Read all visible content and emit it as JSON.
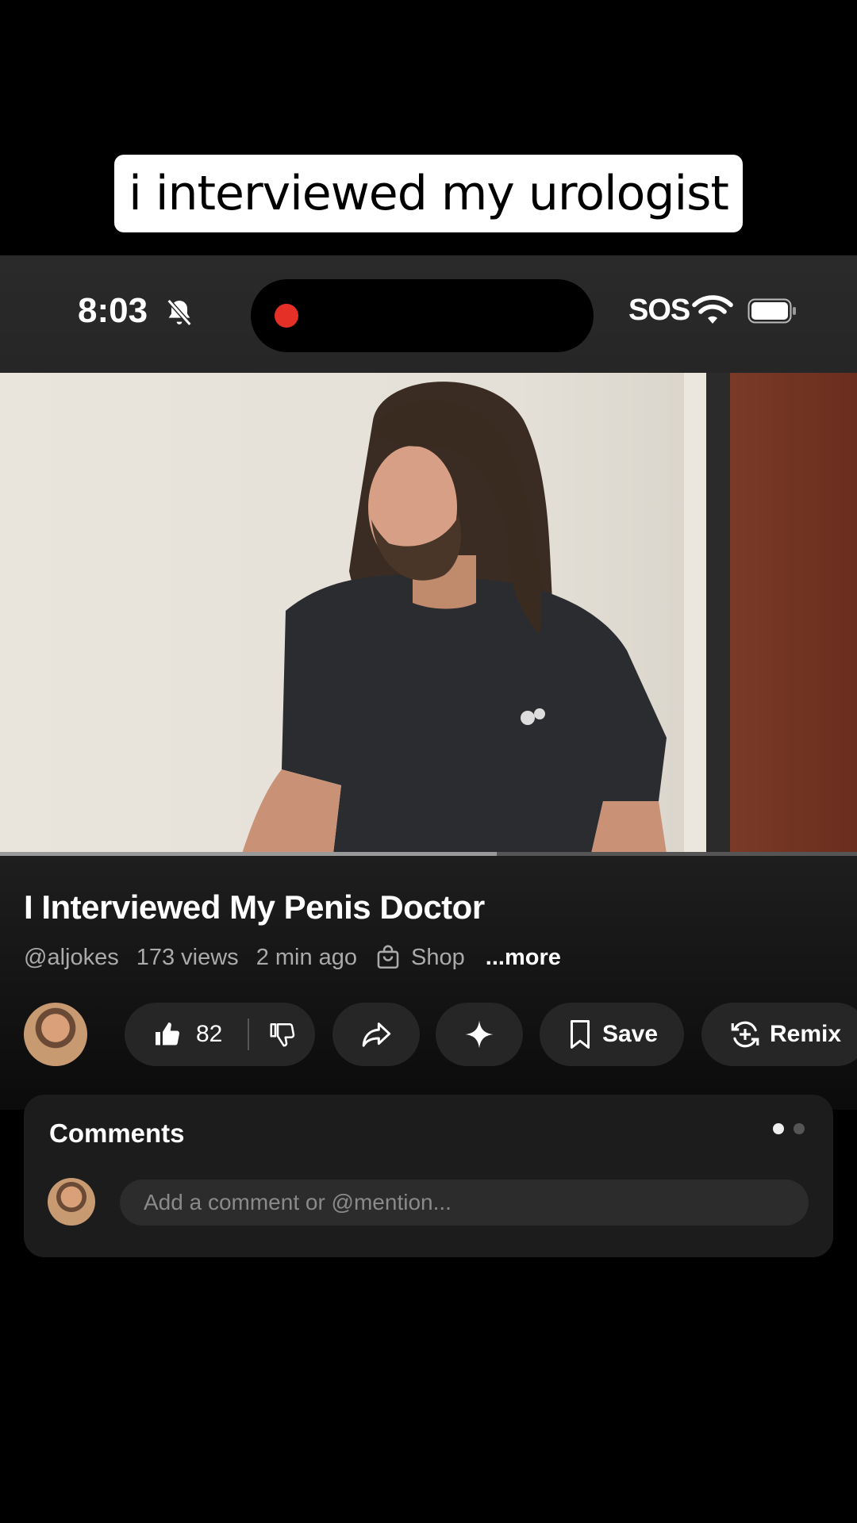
{
  "caption": "i interviewed my urologist",
  "status_bar": {
    "time": "8:03",
    "carrier": "SOS",
    "icons": [
      "bell-slash-icon",
      "recording-dot-icon",
      "wifi-icon",
      "battery-icon"
    ],
    "recording_color": "#e53028"
  },
  "video": {
    "progress": 0.58
  },
  "info": {
    "title": "I Interviewed My Penis Doctor",
    "channel": "@aljokes",
    "views": "173 views",
    "time_ago": "2 min ago",
    "shop_label": "Shop",
    "more_label": "...more"
  },
  "actions": {
    "like_count": "82",
    "save_label": "Save",
    "remix_label": "Remix"
  },
  "comments": {
    "title": "Comments",
    "placeholder": "Add a comment or @mention..."
  }
}
